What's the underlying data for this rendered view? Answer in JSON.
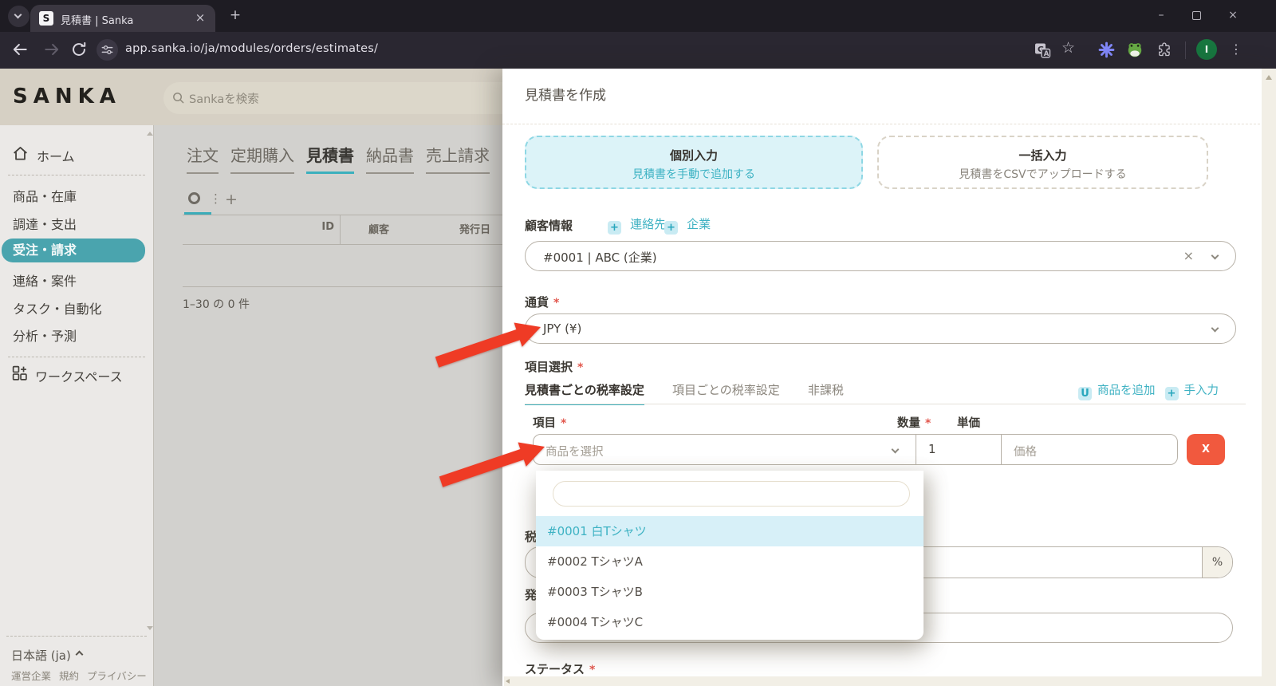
{
  "browser": {
    "tab_title": "見積書 | Sanka",
    "favicon_letter": "S",
    "url": "app.sanka.io/ja/modules/orders/estimates/",
    "profile_initial": "I"
  },
  "header": {
    "logo": "SANKA",
    "search_placeholder": "Sankaを検索"
  },
  "sidebar": {
    "items": [
      {
        "label": "ホーム"
      },
      {
        "label": "商品・在庫"
      },
      {
        "label": "調達・支出"
      },
      {
        "label": "受注・請求",
        "active": true
      },
      {
        "label": "連絡・案件"
      },
      {
        "label": "タスク・自動化"
      },
      {
        "label": "分析・予測"
      },
      {
        "label": "ワークスペース"
      }
    ],
    "language": "日本語 (ja)",
    "footer_links": [
      {
        "label": "運営企業"
      },
      {
        "label": "規約"
      },
      {
        "label": "プライバシー"
      }
    ]
  },
  "main": {
    "tabs": [
      {
        "label": "注文"
      },
      {
        "label": "定期購入"
      },
      {
        "label": "見積書",
        "active": true
      },
      {
        "label": "納品書"
      },
      {
        "label": "売上請求"
      }
    ],
    "table": {
      "columns": [
        {
          "label": "ID"
        },
        {
          "label": "顧客"
        },
        {
          "label": "発行日"
        }
      ]
    },
    "pagination": "1–30 の 0 件"
  },
  "drawer": {
    "title": "見積書を作成",
    "cards": [
      {
        "title": "個別入力",
        "subtitle": "見積書を手動で追加する",
        "selected": true
      },
      {
        "title": "一括入力",
        "subtitle": "見積書をCSVでアップロードする",
        "selected": false
      }
    ],
    "customer": {
      "label": "顧客情報",
      "add_contact": "連絡先",
      "add_company": "企業",
      "value": "#0001 | ABC (企業)"
    },
    "currency": {
      "label": "通貨",
      "value": "JPY (¥)"
    },
    "items": {
      "label": "項目選択",
      "tax_tabs": [
        {
          "label": "見積書ごとの税率設定",
          "active": true
        },
        {
          "label": "項目ごとの税率設定"
        },
        {
          "label": "非課税"
        }
      ],
      "add_product": "商品を追加",
      "manual_entry": "手入力",
      "col_item": "項目",
      "col_qty": "数量",
      "col_unit_price": "単価",
      "product_placeholder": "商品を選択",
      "qty_value": "1",
      "price_placeholder": "価格",
      "remove_label": "X"
    },
    "dropdown": {
      "search_value": "",
      "options": [
        {
          "label": "#0001 白Tシャツ",
          "highlighted": true
        },
        {
          "label": "#0002 TシャツA"
        },
        {
          "label": "#0003 TシャツB"
        },
        {
          "label": "#0004 TシャツC"
        }
      ]
    },
    "partial_tax_label": "税",
    "percent_suffix": "%",
    "partial_issue_label": "発",
    "status_label": "ステータス"
  },
  "icons": {
    "close_glyph": "×",
    "plus_glyph": "+",
    "kebab_glyph": "⋮",
    "star_glyph": "☆",
    "clear_glyph": "×",
    "minimize_glyph": "–",
    "u_glyph": "U",
    "required_mark": "*"
  },
  "colors": {
    "teal": "#3fb2c3",
    "sidebar_active_bg": "#4aa4ae",
    "danger": "#f1593e",
    "arrow_red": "#ef3b25",
    "highlight_bg": "#d7f0f8",
    "card_selected_bg": "#dcf3f8"
  }
}
